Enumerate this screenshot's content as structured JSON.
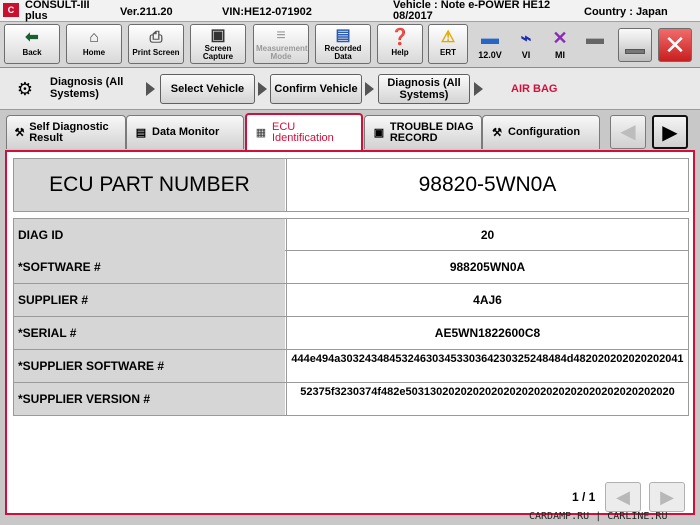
{
  "titlebar": {
    "app_name": "CONSULT-III plus",
    "version": "Ver.211.20",
    "vin": "VIN:HE12-071902",
    "vehicle": "Vehicle : Note e-POWER HE12 08/2017",
    "country": "Country : Japan"
  },
  "toolbar": {
    "back": "Back",
    "home": "Home",
    "print_screen": "Print Screen",
    "screen_capture": "Screen Capture",
    "measurement_mode": "Measurement Mode",
    "recorded_data": "Recorded Data",
    "help": "Help",
    "ert": "ERT",
    "battery_voltage": "12.0V",
    "vi": "VI",
    "mi": "MI"
  },
  "breadcrumb": {
    "first": "Diagnosis (All Systems)",
    "select_vehicle": "Select Vehicle",
    "confirm_vehicle": "Confirm Vehicle",
    "diagnosis_all": "Diagnosis (All Systems)",
    "current": "AIR BAG"
  },
  "tabs": [
    {
      "label": "Self Diagnostic Result"
    },
    {
      "label": "Data Monitor"
    },
    {
      "label": "ECU Identification"
    },
    {
      "label": "TROUBLE DIAG RECORD"
    },
    {
      "label": "Configuration"
    }
  ],
  "part": {
    "label": "ECU PART NUMBER",
    "value": "98820-5WN0A"
  },
  "rows": [
    {
      "key": "DIAG ID",
      "value": "20"
    },
    {
      "key": "*SOFTWARE #",
      "value": "988205WN0A"
    },
    {
      "key": "SUPPLIER #",
      "value": "4AJ6"
    },
    {
      "key": "*SERIAL #",
      "value": "AE5WN1822600C8"
    },
    {
      "key": "*SUPPLIER SOFTWARE #",
      "value": "444e494a3032434845324630345330364230325248484d482020202020202041"
    },
    {
      "key": "*SUPPLIER VERSION #",
      "value": "52375f3230374f482e50313020202020202020202020202020202020202020"
    }
  ],
  "pagination": {
    "text": "1 / 1"
  },
  "watermark": "CARDAMP.RU | CARLINE.RU"
}
